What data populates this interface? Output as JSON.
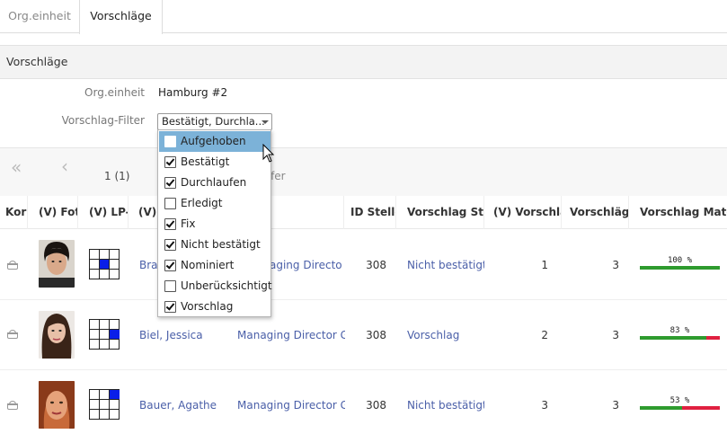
{
  "tabs": [
    {
      "label": "Org.einheit",
      "active": false
    },
    {
      "label": "Vorschläge",
      "active": true
    }
  ],
  "section": {
    "title": "Vorschläge"
  },
  "form": {
    "org_label": "Org.einheit",
    "org_value": "Hamburg #2",
    "filter_label": "Vorschlag-Filter",
    "filter_value": "Bestätigt, Durchla..."
  },
  "dropdown": {
    "options": [
      {
        "label": "Aufgehoben",
        "checked": false,
        "hover": true
      },
      {
        "label": "Bestätigt",
        "checked": true
      },
      {
        "label": "Durchlaufen",
        "checked": true
      },
      {
        "label": "Erledigt",
        "checked": false
      },
      {
        "label": "Fix",
        "checked": true
      },
      {
        "label": "Nicht bestätigt",
        "checked": true
      },
      {
        "label": "Nominiert",
        "checked": true
      },
      {
        "label": "Unberücksichtigt",
        "checked": false
      },
      {
        "label": "Vorschlag",
        "checked": true
      }
    ]
  },
  "pager": {
    "first": "«",
    "prev": "‹",
    "page": "1 (1)",
    "suffix": "ffer"
  },
  "columns": [
    "Korb",
    "(V) Foto",
    "(V) LP-M",
    "(V) N",
    "",
    "ID Stelle",
    "Vorschlag Statu",
    "(V) Vorschläg",
    "Vorschläge",
    "Vorschlag Matchi"
  ],
  "rows": [
    {
      "name": "Brau",
      "position": "aging Director G",
      "id": "308",
      "status": "Nicht bestätigt",
      "v_vorschlaege": "1",
      "vorschlaege": "3",
      "match_label": "100 %",
      "match": 1.0,
      "grid_on": [
        4
      ]
    },
    {
      "name": "Biel, Jessica",
      "position": "Managing Director G",
      "id": "308",
      "status": "Vorschlag",
      "v_vorschlaege": "2",
      "vorschlaege": "3",
      "match_label": "83 %",
      "match": 0.83,
      "grid_on": [
        5
      ]
    },
    {
      "name": "Bauer, Agathe",
      "position": "Managing Director G",
      "id": "308",
      "status": "Nicht bestätigt",
      "v_vorschlaege": "3",
      "vorschlaege": "3",
      "match_label": "53 %",
      "match": 0.53,
      "grid_on": [
        2
      ]
    }
  ],
  "icons": {
    "cart": "basket-icon",
    "cursor": "mouse-pointer-icon"
  },
  "colors": {
    "link": "#4a5fa8",
    "match_green": "#2e9b2e",
    "match_red": "#e02040",
    "grid_on": "#0a1ee8",
    "hover": "#7cb2d8"
  }
}
